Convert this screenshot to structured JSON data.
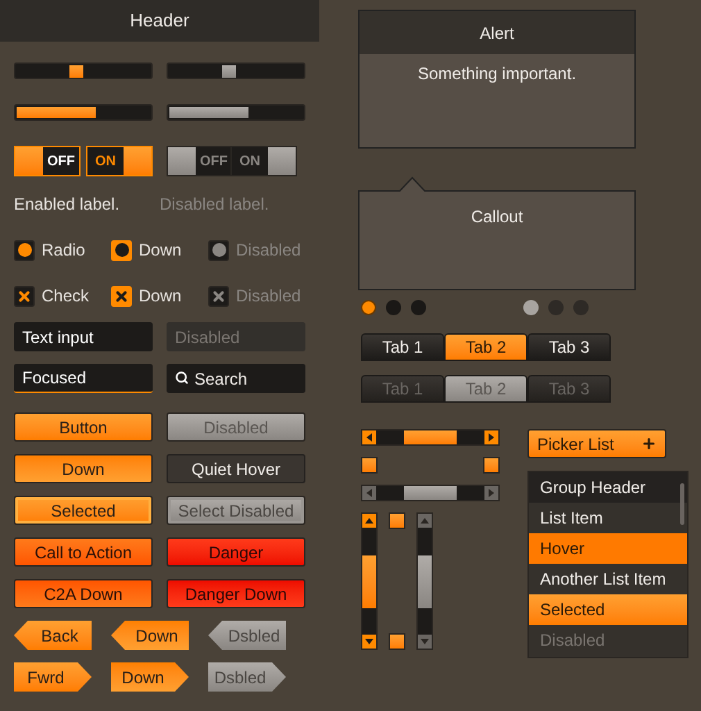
{
  "header": "Header",
  "sliders": [
    {
      "level": 0.4,
      "disabled": false
    },
    {
      "level": 0.4,
      "disabled": true
    }
  ],
  "progress": [
    {
      "level": 0.59,
      "disabled": false
    },
    {
      "level": 0.59,
      "disabled": true
    }
  ],
  "toggles": [
    {
      "label": "OFF",
      "on": false,
      "disabled": false
    },
    {
      "label": "ON",
      "on": true,
      "disabled": false
    },
    {
      "label": "OFF",
      "on": false,
      "disabled": true
    },
    {
      "label": "ON",
      "on": true,
      "disabled": true
    }
  ],
  "labels": [
    {
      "text": "Enabled label.",
      "disabled": false
    },
    {
      "text": "Disabled label.",
      "disabled": true
    }
  ],
  "radios": [
    {
      "label": "Radio",
      "checked": true,
      "pressed": false,
      "disabled": false
    },
    {
      "label": "Down",
      "checked": true,
      "pressed": true,
      "disabled": false
    },
    {
      "label": "Disabled",
      "checked": true,
      "pressed": false,
      "disabled": true
    }
  ],
  "checkboxes": [
    {
      "label": "Check",
      "checked": true,
      "pressed": false,
      "disabled": false
    },
    {
      "label": "Down",
      "checked": true,
      "pressed": true,
      "disabled": false
    },
    {
      "label": "Disabled",
      "checked": true,
      "pressed": false,
      "disabled": true
    }
  ],
  "inputs": [
    {
      "kind": "text",
      "value": "Text input"
    },
    {
      "kind": "disabled",
      "placeholder": "Disabled"
    },
    {
      "kind": "focused",
      "value": "Focused"
    },
    {
      "kind": "search",
      "placeholder": "Search"
    }
  ],
  "buttons": [
    {
      "label": "Button",
      "kind": "normal"
    },
    {
      "label": "Disabled",
      "kind": "disabled"
    },
    {
      "label": "Down",
      "kind": "down"
    },
    {
      "label": "Quiet Hover",
      "kind": "quiet"
    },
    {
      "label": "Selected",
      "kind": "selected"
    },
    {
      "label": "Select Disabled",
      "kind": "select-disabled"
    },
    {
      "label": "Call to Action",
      "kind": "cta"
    },
    {
      "label": "Danger",
      "kind": "danger"
    },
    {
      "label": "C2A Down",
      "kind": "cta-down"
    },
    {
      "label": "Danger Down",
      "kind": "danger-down"
    }
  ],
  "back_buttons": [
    {
      "label": "Back",
      "kind": "normal"
    },
    {
      "label": "Down",
      "kind": "down"
    },
    {
      "label": "Dsbled",
      "kind": "disabled"
    }
  ],
  "forward_buttons": [
    {
      "label": "Fwrd",
      "kind": "normal"
    },
    {
      "label": "Down",
      "kind": "down"
    },
    {
      "label": "Dsbled",
      "kind": "disabled"
    }
  ],
  "alert": {
    "title": "Alert",
    "message": "Something important."
  },
  "callout": {
    "text": "Callout"
  },
  "pagers": [
    {
      "disabled": false,
      "dots": [
        {
          "selected": true
        },
        {
          "selected": false
        },
        {
          "selected": false
        }
      ]
    },
    {
      "disabled": true,
      "dots": [
        {
          "selected": true
        },
        {
          "selected": false
        },
        {
          "selected": false
        }
      ]
    }
  ],
  "tab_groups": [
    {
      "disabled": false,
      "tabs": [
        {
          "label": "Tab 1",
          "selected": false
        },
        {
          "label": "Tab 2",
          "selected": true
        },
        {
          "label": "Tab 3",
          "selected": false
        }
      ]
    },
    {
      "disabled": true,
      "tabs": [
        {
          "label": "Tab 1",
          "selected": false
        },
        {
          "label": "Tab 2",
          "selected": true
        },
        {
          "label": "Tab 3",
          "selected": false
        }
      ]
    }
  ],
  "horizontal_scrollbars": [
    {
      "disabled": false
    },
    {
      "disabled": true
    }
  ],
  "vertical_scrollbars": [
    {
      "disabled": false
    },
    {
      "disabled": true
    }
  ],
  "picker": {
    "label": "Picker List"
  },
  "list": [
    {
      "label": "Group Header",
      "kind": "header",
      "selected": false
    },
    {
      "label": "List Item",
      "kind": "item",
      "selected": false
    },
    {
      "label": "Hover",
      "kind": "hover",
      "selected": false
    },
    {
      "label": "Another List Item",
      "kind": "item",
      "selected": false
    },
    {
      "label": "Selected",
      "kind": "item",
      "selected": true
    },
    {
      "label": "Disabled",
      "kind": "disabled",
      "selected": false
    }
  ]
}
